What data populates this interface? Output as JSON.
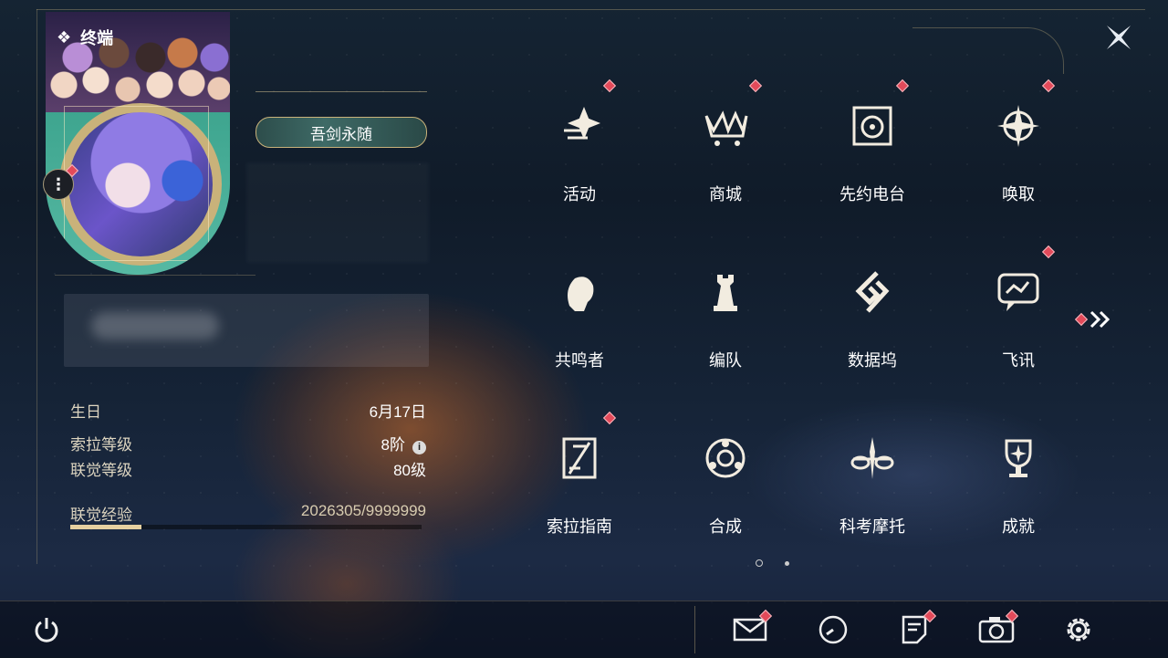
{
  "header": {
    "title": "终端"
  },
  "profile": {
    "title_badge": "吾剑永随"
  },
  "info": {
    "birthday_label": "生日",
    "birthday_value": "6月17日",
    "sola_level_label": "索拉等级",
    "sola_level_value": "8阶",
    "union_level_label": "联觉等级",
    "union_level_value": "80级",
    "exp_label": "联觉经验",
    "exp_value": "2026305/9999999",
    "exp_fraction": 0.2026
  },
  "menu": [
    {
      "label": "活动",
      "icon": "sparkle-activity-icon",
      "badge": true
    },
    {
      "label": "商城",
      "icon": "crown-cart-icon",
      "badge": true
    },
    {
      "label": "先约电台",
      "icon": "radio-speaker-icon",
      "badge": true
    },
    {
      "label": "唤取",
      "icon": "compass-star-icon",
      "badge": true
    },
    {
      "label": "共鸣者",
      "icon": "resonator-head-icon",
      "badge": false
    },
    {
      "label": "编队",
      "icon": "chess-rook-icon",
      "badge": false
    },
    {
      "label": "数据坞",
      "icon": "data-dock-icon",
      "badge": false
    },
    {
      "label": "飞讯",
      "icon": "chat-bubble-icon",
      "badge": true
    },
    {
      "label": "索拉指南",
      "icon": "guide-book-icon",
      "badge": true
    },
    {
      "label": "合成",
      "icon": "synthesis-circle-icon",
      "badge": false
    },
    {
      "label": "科考摩托",
      "icon": "motorbike-icon",
      "badge": false
    },
    {
      "label": "成就",
      "icon": "trophy-icon",
      "badge": false
    }
  ],
  "colors": {
    "badge_red": "#e34a5a",
    "gold": "#c9b27a",
    "exp_fill": "#e6d0a0"
  },
  "bottom_bar": [
    "power-icon",
    "mail-icon",
    "clock-icon",
    "notes-icon",
    "camera-icon",
    "settings-gear-icon"
  ]
}
